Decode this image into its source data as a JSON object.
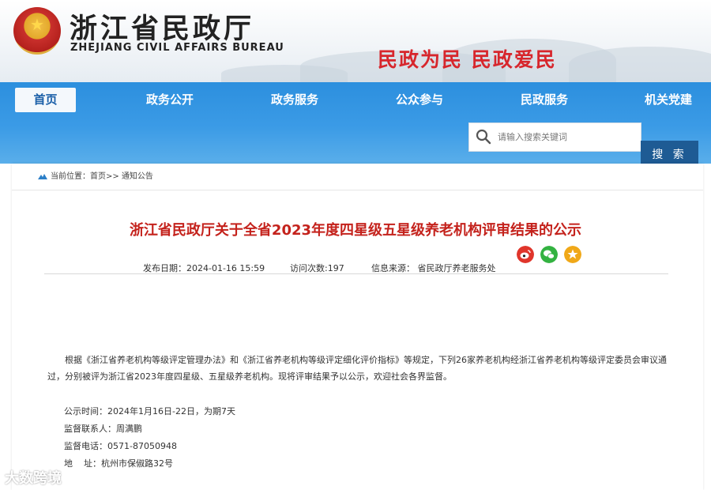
{
  "header": {
    "title_cn": "浙江省民政厅",
    "title_en": "ZHEJIANG CIVIL AFFAIRS BUREAU",
    "slogan": "民政为民  民政爱民",
    "emblem_icon": "national-emblem-icon"
  },
  "nav": {
    "items": [
      {
        "label": "首页",
        "active": true
      },
      {
        "label": "政务公开",
        "active": false
      },
      {
        "label": "政务服务",
        "active": false
      },
      {
        "label": "公众参与",
        "active": false
      },
      {
        "label": "民政服务",
        "active": false
      },
      {
        "label": "机关党建",
        "active": false
      }
    ]
  },
  "search": {
    "placeholder": "请输入搜索关键词",
    "value": "",
    "button_label": "搜 索",
    "icon": "search-icon"
  },
  "breadcrumb": {
    "icon": "location-icon",
    "text": "当前位置：首页>> 通知公告"
  },
  "article": {
    "title": "浙江省民政厅关于全省2023年度四星级五星级养老机构评审结果的公示",
    "publish_date": "发布日期：2024-01-16 15:59",
    "visits": "访问次数:197",
    "source": "信息来源：  省民政厅养老服务处",
    "share": [
      {
        "name": "weibo-icon",
        "color": "#e0352b"
      },
      {
        "name": "wechat-icon",
        "color": "#33b241"
      },
      {
        "name": "favorite-icon",
        "color": "#f0a818"
      }
    ],
    "body": "根据《浙江省养老机构等级评定管理办法》和《浙江省养老机构等级评定细化评价指标》等规定，下列26家养老机构经浙江省养老机构等级评定委员会审议通过，分别被评为浙江省2023年度四星级、五星级养老机构。现将评审结果予以公示，欢迎社会各界监督。",
    "info": [
      "公示时间：2024年1月16日-22日，为期7天",
      "监督联系人：周满鹏",
      "监督电话：0571-87050948",
      "地    址：杭州市保俶路32号"
    ]
  },
  "watermark": "大数跨境",
  "colors": {
    "nav_blue": "#3b9be6",
    "title_red": "#c4221c",
    "search_button": "#1e5b94",
    "slogan_red": "#d7262c"
  }
}
